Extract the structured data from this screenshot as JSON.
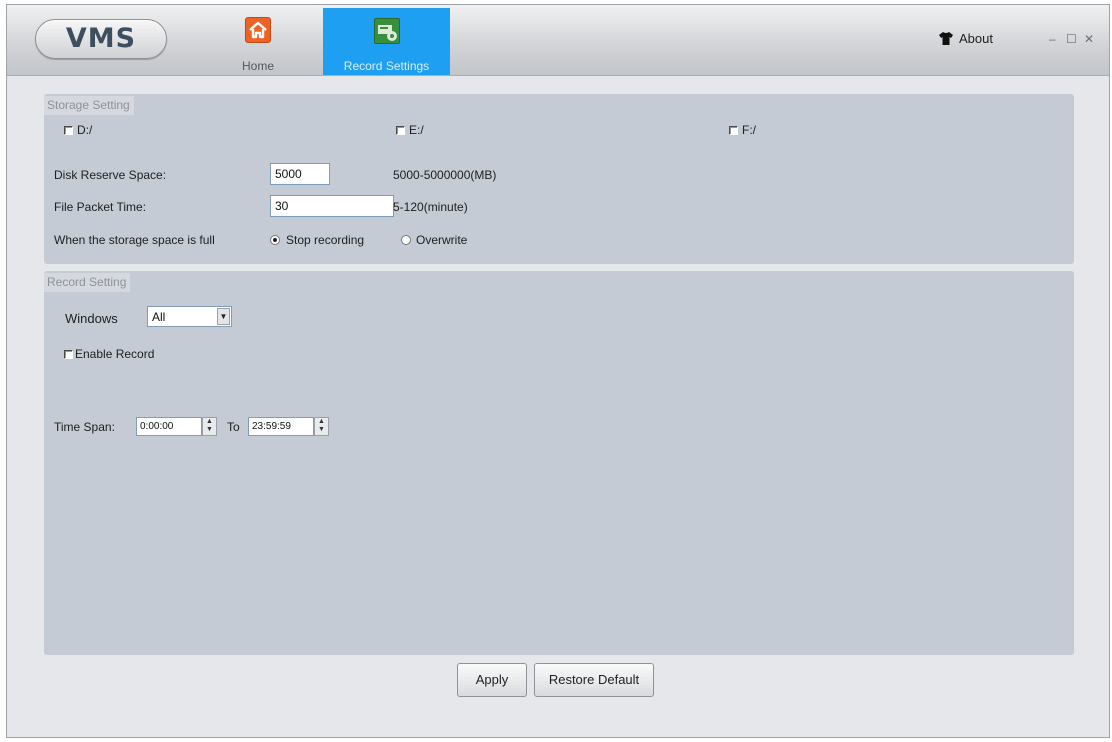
{
  "app": {
    "logo_text": "VMS"
  },
  "tabs": [
    {
      "label": "Home",
      "icon": "home-icon"
    },
    {
      "label": "Record Settings",
      "icon": "record-settings-icon",
      "active": true
    }
  ],
  "header": {
    "about_label": "About",
    "about_icon": "tshirt-icon"
  },
  "window_controls": {
    "minimize": "–",
    "maximize": "☐",
    "close": "✕"
  },
  "storage": {
    "title": "Storage Setting",
    "drives": [
      {
        "label": "D:/",
        "checked": false
      },
      {
        "label": "E:/",
        "checked": false
      },
      {
        "label": "F:/",
        "checked": false
      }
    ],
    "disk_reserve_label": "Disk Reserve Space:",
    "disk_reserve_value": "5000",
    "disk_reserve_range": "5000-5000000(MB)",
    "packet_time_label": "File Packet Time:",
    "packet_time_value": "30",
    "packet_time_range": "5-120(minute)",
    "full_label": "When the storage space is full",
    "full_options": [
      {
        "label": "Stop recording",
        "selected": true
      },
      {
        "label": "Overwrite",
        "selected": false
      }
    ]
  },
  "record": {
    "title": "Record Setting",
    "windows_label": "Windows",
    "windows_value": "All",
    "enable_label": "Enable Record",
    "enable_checked": false,
    "time_span_label": "Time Span:",
    "time_start": "0:00:00",
    "to_label": "To",
    "time_end": "23:59:59"
  },
  "footer": {
    "apply_label": "Apply",
    "restore_label": "Restore Default"
  },
  "colors": {
    "active_tab": "#1f9ff2",
    "panel": "#c5cbd4",
    "home_icon": "#ee6325"
  }
}
